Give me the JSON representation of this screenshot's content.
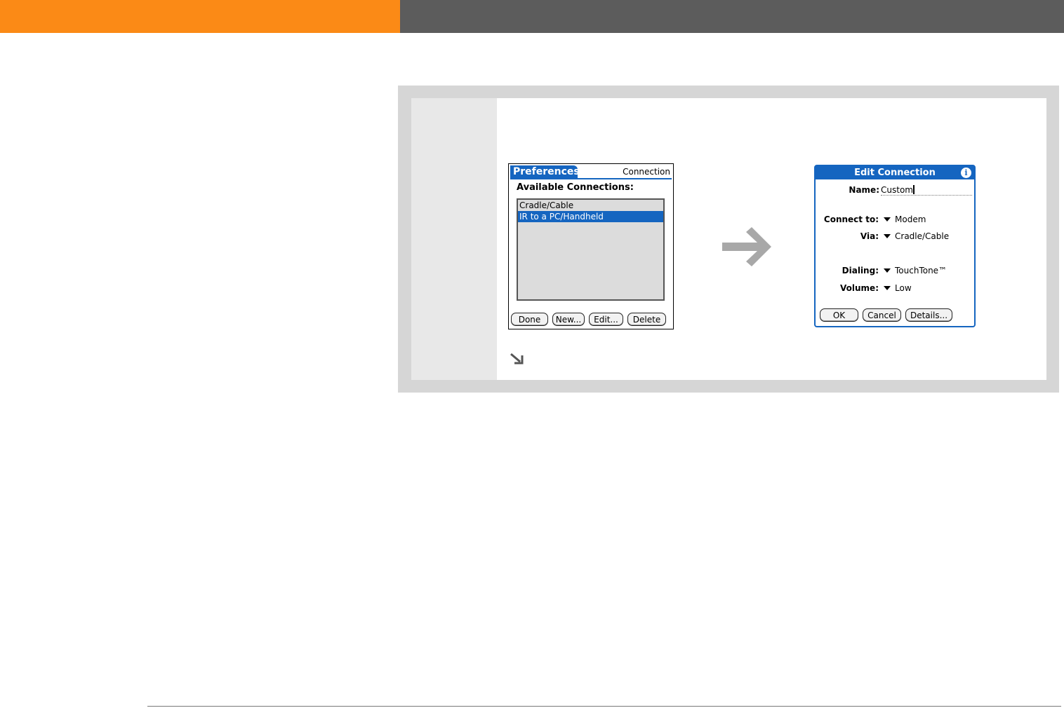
{
  "screen1": {
    "tab_title": "Preferences",
    "panel_name": "Connection",
    "heading": "Available Connections:",
    "list_items": [
      {
        "label": "Cradle/Cable",
        "selected": false
      },
      {
        "label": "IR to a PC/Handheld",
        "selected": true
      }
    ],
    "buttons": {
      "done": "Done",
      "new": "New...",
      "edit": "Edit...",
      "delete": "Delete"
    }
  },
  "screen2": {
    "title": "Edit Connection",
    "info_icon": "i",
    "fields": {
      "name_label": "Name:",
      "name_value": "Custom",
      "connect_to_label": "Connect to:",
      "connect_to_value": "Modem",
      "via_label": "Via:",
      "via_value": "Cradle/Cable",
      "dialing_label": "Dialing:",
      "dialing_value": "TouchTone™",
      "volume_label": "Volume:",
      "volume_value": "Low"
    },
    "buttons": {
      "ok": "OK",
      "cancel": "Cancel",
      "details": "Details..."
    }
  },
  "icons": {
    "flow_arrow": "right-arrow-icon",
    "continue_arrow": "down-right-arrow-icon"
  },
  "colors": {
    "orange_bar": "#fb8a16",
    "dark_bar": "#5c5c5c",
    "palm_blue": "#1565c0"
  }
}
